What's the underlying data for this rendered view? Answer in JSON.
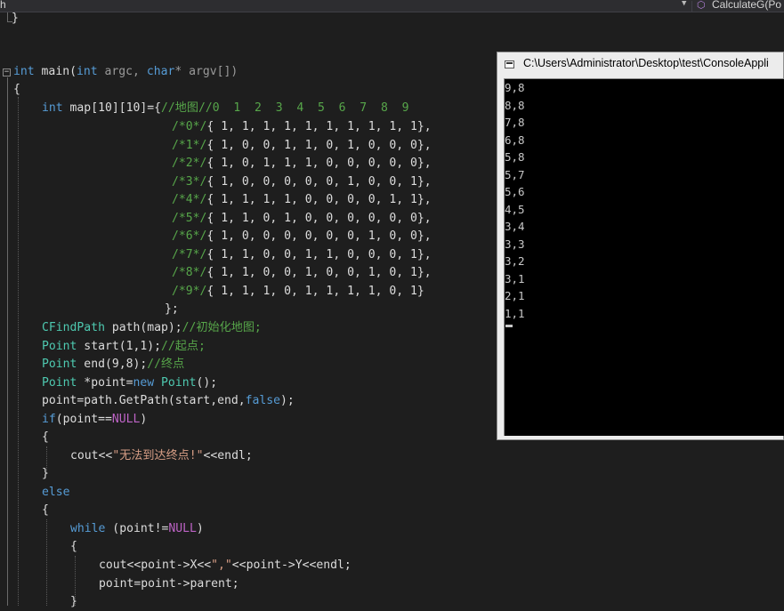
{
  "navbar": {
    "left_fragment": "h",
    "method_name": "CalculateG(Po"
  },
  "code": {
    "l0": "}",
    "l3": {
      "kw_int": "int",
      "sp": " ",
      "fn": "main(",
      "kw_int2": "int",
      "p1": " argc, ",
      "kw_char": "char",
      "p2": "* argv[])"
    },
    "l4": "{",
    "l5": {
      "a": "int",
      "b": " map[10][10]={",
      "c": "//地图//0  1  2  3  4  5  6  7  8  9"
    },
    "rows": [
      {
        "label": "/*0*/",
        "vals": "{ 1, 1, 1, 1, 1, 1, 1, 1, 1, 1},"
      },
      {
        "label": "/*1*/",
        "vals": "{ 1, 0, 0, 1, 1, 0, 1, 0, 0, 0},"
      },
      {
        "label": "/*2*/",
        "vals": "{ 1, 0, 1, 1, 1, 0, 0, 0, 0, 0},"
      },
      {
        "label": "/*3*/",
        "vals": "{ 1, 0, 0, 0, 0, 0, 1, 0, 0, 1},"
      },
      {
        "label": "/*4*/",
        "vals": "{ 1, 1, 1, 1, 0, 0, 0, 0, 1, 1},"
      },
      {
        "label": "/*5*/",
        "vals": "{ 1, 1, 0, 1, 0, 0, 0, 0, 0, 0},"
      },
      {
        "label": "/*6*/",
        "vals": "{ 1, 0, 0, 0, 0, 0, 0, 1, 0, 0},"
      },
      {
        "label": "/*7*/",
        "vals": "{ 1, 1, 0, 0, 1, 1, 0, 0, 0, 1},"
      },
      {
        "label": "/*8*/",
        "vals": "{ 1, 1, 0, 0, 1, 0, 0, 1, 0, 1},"
      },
      {
        "label": "/*9*/",
        "vals": "{ 1, 1, 1, 0, 1, 1, 1, 1, 0, 1}"
      }
    ],
    "l16": "};",
    "l17": {
      "ty": "CFindPath",
      "rest": " path(map);",
      "cm": "//初始化地图;"
    },
    "l18": {
      "ty": "Point",
      "rest": " start(1,1);",
      "cm": "//起点;"
    },
    "l19": {
      "ty": "Point",
      "rest": " end(9,8);",
      "cm": "//终点"
    },
    "l20": {
      "ty": "Point",
      "rest1": " *point=",
      "kw": "new",
      "sp": " ",
      "ty2": "Point",
      "rest2": "();"
    },
    "l21": {
      "a": "point=path.GetPath(start,end,",
      "kw": "false",
      "b": ");"
    },
    "l22": {
      "kw": "if",
      "a": "(point==",
      "mc": "NULL",
      "b": ")"
    },
    "l23": "{",
    "l24": {
      "a": "cout<<",
      "st": "\"无法到达终点!\"",
      "b": "<<endl;"
    },
    "l25": "}",
    "l26": {
      "kw": "else"
    },
    "l27": "{",
    "l28": {
      "kw": "while",
      "a": " (point!=",
      "mc": "NULL",
      "b": ")"
    },
    "l29": "{",
    "l30": {
      "a": "cout<<point->X<<",
      "st": "\",\"",
      "b": "<<point->Y<<endl;"
    },
    "l31": "point=point->parent;",
    "l32": "}"
  },
  "console": {
    "title": "C:\\Users\\Administrator\\Desktop\\test\\ConsoleAppli",
    "output": [
      "9,8",
      "8,8",
      "7,8",
      "6,8",
      "5,8",
      "5,7",
      "5,6",
      "4,5",
      "3,4",
      "3,3",
      "3,2",
      "3,1",
      "2,1",
      "1,1"
    ]
  },
  "colors": {
    "editor_bg": "#1e1e1e",
    "keyword": "#569cd6",
    "type": "#4ec9b0",
    "comment": "#57a64a",
    "string": "#d69d85",
    "macro": "#bd63c5",
    "console_bg": "#000000",
    "console_text": "#c8c8c8"
  }
}
